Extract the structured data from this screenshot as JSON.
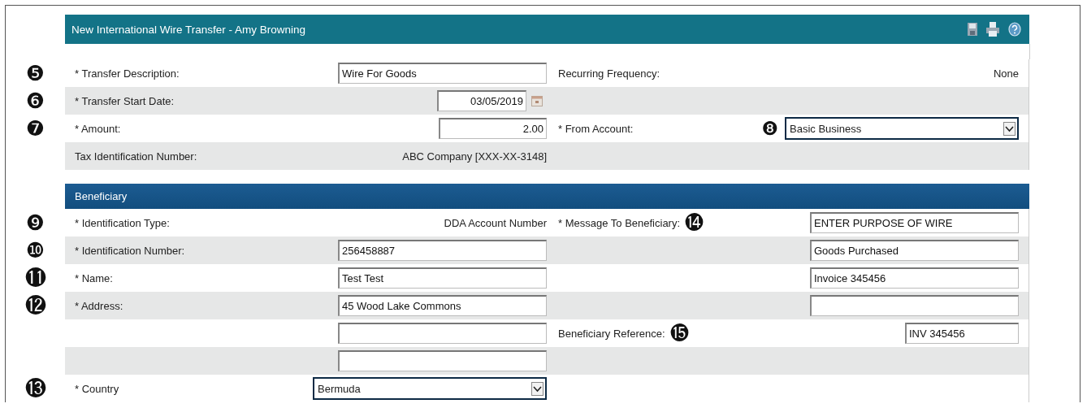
{
  "title": "New International Wire Transfer - Amy Browning",
  "rows": [
    {
      "callout": "❺",
      "left": {
        "label": "* Transfer Description:",
        "field": {
          "kind": "input",
          "value": "Wire For Goods"
        }
      },
      "right": {
        "label": "Recurring Frequency:",
        "field": {
          "kind": "text",
          "value": "None"
        }
      }
    },
    {
      "callout": "❻",
      "left": {
        "label": "* Transfer Start Date:",
        "field": {
          "kind": "date",
          "value": "03/05/2019"
        }
      }
    },
    {
      "callout": "❼",
      "left": {
        "label": "* Amount:",
        "field": {
          "kind": "amount",
          "value": "2.00"
        }
      },
      "right": {
        "label": "* From Account:",
        "field_callout": "❽",
        "field": {
          "kind": "select",
          "value": "Basic Business"
        }
      }
    },
    {
      "left": {
        "label": "Tax Identification Number:",
        "field": {
          "kind": "text",
          "value": "ABC Company [XXX-XX-3148]"
        }
      }
    }
  ],
  "beneficiary": {
    "heading": "Beneficiary",
    "rows": [
      {
        "callout": "❾",
        "left": {
          "label": "* Identification Type:",
          "field": {
            "kind": "text",
            "value": "DDA Account Number"
          }
        },
        "right": {
          "label": "* Message To Beneficiary:",
          "callout": "⓮",
          "field": {
            "kind": "input",
            "value": "ENTER PURPOSE OF WIRE"
          }
        }
      },
      {
        "callout": "❿",
        "left": {
          "label": "* Identification Number:",
          "field": {
            "kind": "input",
            "value": "256458887"
          }
        },
        "right": {
          "field": {
            "kind": "input",
            "value": "Goods Purchased"
          }
        }
      },
      {
        "callout": "⓫",
        "left": {
          "label": "* Name:",
          "field": {
            "kind": "input",
            "value": "Test Test"
          }
        },
        "right": {
          "field": {
            "kind": "input",
            "value": "Invoice 345456"
          }
        }
      },
      {
        "callout": "⓬",
        "left": {
          "label": "* Address:",
          "field": {
            "kind": "input",
            "value": "45 Wood Lake Commons"
          }
        },
        "right": {
          "field": {
            "kind": "input"
          }
        }
      },
      {
        "left": {
          "field": {
            "kind": "input"
          }
        },
        "right": {
          "label": "Beneficiary Reference:",
          "callout": "⓯",
          "field": {
            "kind": "short-input",
            "value": "INV 345456"
          }
        }
      },
      {
        "left": {
          "field": {
            "kind": "input"
          }
        }
      },
      {
        "callout": "⓭",
        "left": {
          "label": "* Country",
          "field": {
            "kind": "select",
            "value": "Bermuda"
          }
        }
      }
    ]
  }
}
